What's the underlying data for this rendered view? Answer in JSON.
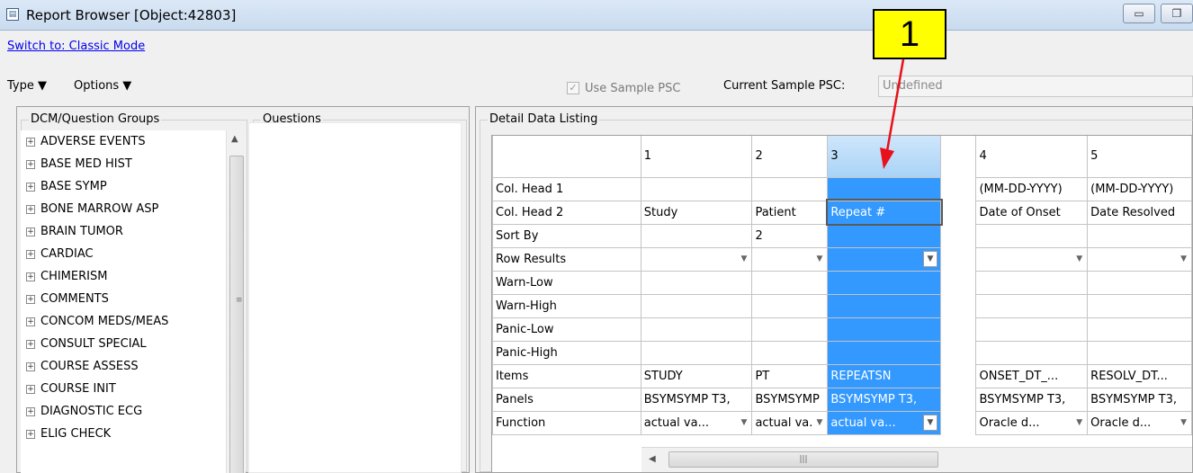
{
  "window": {
    "title": "Report Browser [Object:42803]",
    "app_icon": "window-icon",
    "controls": [
      "minimize-icon",
      "restore-icon"
    ]
  },
  "switch_link": "Switch to: Classic Mode",
  "menus": {
    "type": "Type ▼",
    "options": "Options ▼"
  },
  "sample_psc": {
    "checkbox_label": "Use Sample PSC",
    "checked": true,
    "current_label": "Current Sample PSC:",
    "current_value": "Undefined"
  },
  "groups_panel": {
    "title": "DCM/Question Groups",
    "items": [
      "ADVERSE EVENTS",
      "BASE MED HIST",
      "BASE SYMP",
      "BONE MARROW ASP",
      "BRAIN TUMOR",
      "CARDIAC",
      "CHIMERISM",
      "COMMENTS",
      "CONCOM MEDS/MEAS",
      "CONSULT SPECIAL",
      "COURSE ASSESS",
      "COURSE INIT",
      "DIAGNOSTIC ECG",
      "ELIG CHECK"
    ]
  },
  "questions_panel": {
    "title": "Questions"
  },
  "detail": {
    "title": "Detail Data Listing",
    "columns": [
      "1",
      "2",
      "3",
      "4",
      "5"
    ],
    "rows": {
      "col_head_1": {
        "label": "Col. Head 1",
        "cells": [
          "",
          "",
          "",
          "(MM-DD-YYYY)",
          "(MM-DD-YYYY)"
        ]
      },
      "col_head_2": {
        "label": "Col. Head 2",
        "cells": [
          "Study",
          "Patient",
          "Repeat #",
          "Date of Onset",
          "Date Resolved"
        ]
      },
      "sort_by": {
        "label": "Sort By",
        "cells": [
          "",
          "2",
          "",
          "",
          ""
        ]
      },
      "row_results": {
        "label": "Row Results",
        "cells": [
          "",
          "",
          "",
          "",
          ""
        ]
      },
      "warn_low": {
        "label": "Warn-Low",
        "cells": [
          "",
          "",
          "",
          "",
          ""
        ]
      },
      "warn_high": {
        "label": "Warn-High",
        "cells": [
          "",
          "",
          "",
          "",
          ""
        ]
      },
      "panic_low": {
        "label": "Panic-Low",
        "cells": [
          "",
          "",
          "",
          "",
          ""
        ]
      },
      "panic_high": {
        "label": "Panic-High",
        "cells": [
          "",
          "",
          "",
          "",
          ""
        ]
      },
      "items": {
        "label": "Items",
        "cells": [
          "STUDY",
          "PT",
          "REPEATSN",
          "ONSET_DT_...",
          "RESOLV_DT..."
        ]
      },
      "panels": {
        "label": "Panels",
        "cells": [
          "BSYMSYMP T3,",
          "BSYMSYMP",
          "BSYMSYMP T3,",
          "BSYMSYMP T3,",
          "BSYMSYMP T3,"
        ]
      },
      "function": {
        "label": "Function",
        "cells": [
          "actual va...",
          "actual va.",
          "actual va...",
          "Oracle d...",
          "Oracle d..."
        ]
      }
    }
  },
  "callout": {
    "label": "1",
    "color": "#ffff00",
    "arrow_color": "#e8101a"
  },
  "colors": {
    "selection": "#3399ff",
    "link": "#0000ee"
  }
}
